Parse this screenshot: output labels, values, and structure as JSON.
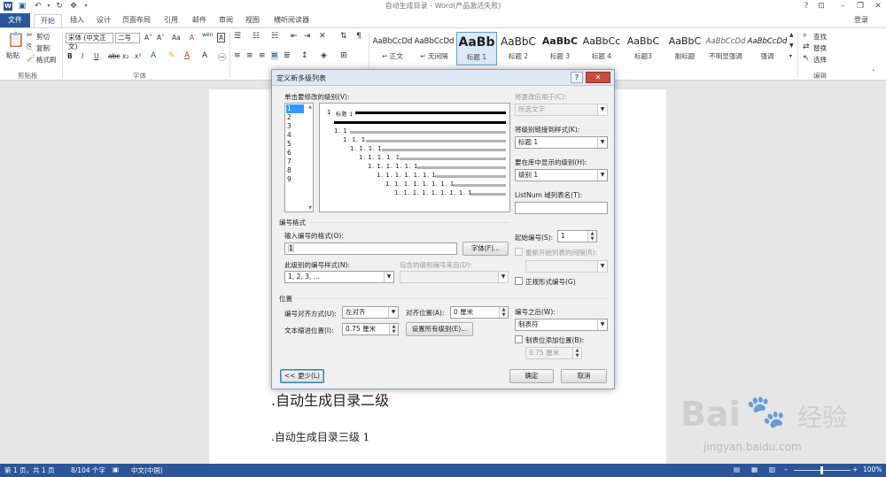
{
  "titlebar": {
    "doc_title": "自动生成目录 - Word(产品激活失败)",
    "help": "?",
    "ribbon_opts": "⊡",
    "minimize": "–",
    "restore": "❐",
    "close": "✕"
  },
  "tabs": [
    "文件",
    "开始",
    "插入",
    "设计",
    "页面布局",
    "引用",
    "邮件",
    "审阅",
    "视图",
    "横听阅读器"
  ],
  "active_tab": "开始",
  "login": "登录",
  "ribbon": {
    "clipboard": {
      "paste": "粘贴",
      "cut": "剪切",
      "copy": "复制",
      "format_painter": "格式刷",
      "label": "剪贴板"
    },
    "font": {
      "name": "宋体 (中文正文)",
      "size": "二号",
      "grow": "A˄",
      "shrink": "A˅",
      "change_case": "Aa",
      "clear": "A",
      "pinyin": "wén",
      "border_char": "A",
      "bold": "B",
      "italic": "I",
      "underline": "U",
      "strike": "abc",
      "sub": "x₂",
      "sup": "x²",
      "label": "字体"
    },
    "paragraph": {
      "label": "段落"
    },
    "styles": {
      "items": [
        {
          "sample": "AaBbCcDd",
          "name": "↵ 正文"
        },
        {
          "sample": "AaBbCcDd",
          "name": "↵ 无间隔"
        },
        {
          "sample": "AaBb",
          "name": "标题 1"
        },
        {
          "sample": "AaBbC",
          "name": "标题 2"
        },
        {
          "sample": "AaBbC",
          "name": "标题 3"
        },
        {
          "sample": "AaBbCc",
          "name": "标题 4"
        },
        {
          "sample": "AaBbC",
          "name": "标题3"
        },
        {
          "sample": "AaBbC",
          "name": "副标题"
        },
        {
          "sample": "AaBbCcDd",
          "name": "不明显强调"
        },
        {
          "sample": "AaBbCcDd",
          "name": "强调"
        }
      ],
      "selected": "标题 1",
      "label": "样式"
    },
    "editing": {
      "find": "查找",
      "replace": "替换",
      "select": "选择",
      "label": "编辑"
    }
  },
  "document": {
    "line2": "自动生成目录二级",
    "line3": "自动生成目录三级 1",
    "bullet": "."
  },
  "statusbar": {
    "page": "第 1 页，共 1 页",
    "words": "8/104 个字",
    "lang": "中文(中国)",
    "zoom": "100%"
  },
  "dialog": {
    "title": "定义新多级列表",
    "help": "?",
    "close": "✕",
    "level_label": "单击要修改的级别(V):",
    "levels": [
      "1",
      "2",
      "3",
      "4",
      "5",
      "6",
      "7",
      "8",
      "9"
    ],
    "selected_level": "1",
    "preview_first_num": "1",
    "preview_first_style": "标题 1",
    "preview_nums": [
      "1. 1",
      "1. 1. 1",
      "1. 1. 1. 1",
      "1. 1. 1. 1. 1",
      "1. 1. 1. 1. 1. 1",
      "1. 1. 1. 1. 1. 1. 1",
      "1. 1. 1. 1. 1. 1. 1. 1",
      "1. 1. 1. 1. 1. 1. 1. 1. 1"
    ],
    "apply_to_label": "将更改应用于(C):",
    "apply_to_value": "所选文字",
    "link_style_label": "将级别链接到样式(K):",
    "link_style_value": "标题 1",
    "gallery_level_label": "要在库中显示的级别(H):",
    "gallery_level_value": "级别 1",
    "listnum_label": "ListNum 域列表名(T):",
    "listnum_value": "",
    "number_format_header": "编号格式",
    "enter_format_label": "输入编号的格式(O):",
    "enter_format_value": "1",
    "font_button": "字体(F)...",
    "start_at_label": "起始编号(S):",
    "start_at_value": "1",
    "restart_label": "重新开始列表的间隔(R):",
    "number_style_label": "此级别的编号样式(N):",
    "number_style_value": "1, 2, 3, ...",
    "include_from_label": "包含的级别编号来自(D):",
    "include_from_value": "",
    "legal_label": "正规形式编号(G)",
    "position_header": "位置",
    "alignment_label": "编号对齐方式(U):",
    "alignment_value": "左对齐",
    "aligned_at_label": "对齐位置(A):",
    "aligned_at_value": "0 厘米",
    "text_indent_label": "文本缩进位置(I):",
    "text_indent_value": "0.75 厘米",
    "set_all_button": "设置所有级别(E)...",
    "follow_label": "编号之后(W):",
    "follow_value": "制表符",
    "tab_add_label": "制表位添加位置(B):",
    "tab_add_value": "0.75 厘米",
    "less_button": "<< 更少(L)",
    "ok_button": "确定",
    "cancel_button": "取消"
  },
  "watermark": {
    "brand": "Bai",
    "brand_cn": "经验",
    "url": "jingyan.baidu.com"
  },
  "colors": {
    "accent": "#2b579a",
    "selection": "#3399ff"
  }
}
